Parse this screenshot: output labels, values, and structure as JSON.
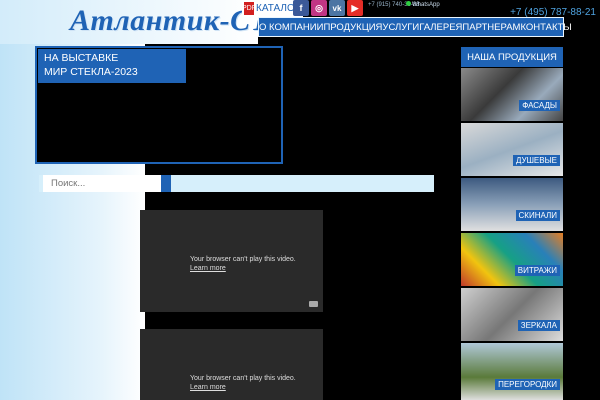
{
  "header": {
    "logo_text": "Атлантик-СТ",
    "catalog_label": "КАТАЛОГ",
    "phone_small": "+7 (915) 740-33-88",
    "whatsapp": "WhatsApp",
    "phone_main": "+7 (495) 787-88-21"
  },
  "social": {
    "facebook": "f",
    "instagram": "◎",
    "vk": "vk",
    "youtube": "▶"
  },
  "nav": {
    "items": [
      "О КОМПАНИИ",
      "ПРОДУКЦИЯ",
      "УСЛУГИ",
      "ГАЛЕРЕЯ",
      "ПАРТНЕРАМ",
      "КОНТАКТЫ"
    ]
  },
  "promo": {
    "line1": "НА ВЫСТАВКЕ",
    "line2": "МИР СТЕКЛА-2023"
  },
  "search": {
    "placeholder": "Поиск..."
  },
  "videos": [
    {
      "message": "Your browser can't play this video.",
      "link": "Learn more"
    },
    {
      "message": "Your browser can't play this video.",
      "link": "Learn more"
    }
  ],
  "sidebar": {
    "title": "НАША ПРОДУКЦИЯ",
    "products": [
      "ФАСАДЫ",
      "ДУШЕВЫЕ",
      "СКИНАЛИ",
      "ВИТРАЖИ",
      "ЗЕРКАЛА",
      "ПЕРЕГОРОДКИ"
    ]
  },
  "colors": {
    "brand_blue": "#1f63b5",
    "background": "#000000",
    "search_bar": "#d6effb"
  }
}
